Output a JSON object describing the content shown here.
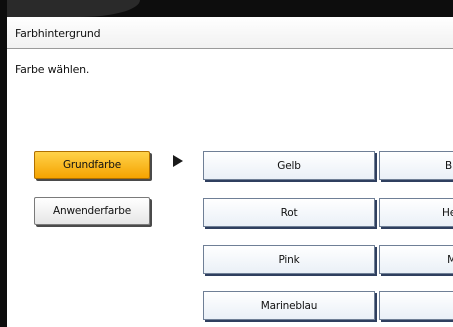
{
  "dialog": {
    "title": "Farbhintergrund",
    "instruction": "Farbe wählen."
  },
  "mode_buttons": [
    {
      "label": "Grundfarbe",
      "selected": true
    },
    {
      "label": "Anwenderfarbe",
      "selected": false
    }
  ],
  "selection_indicator": "arrow-right-icon",
  "colors": {
    "column1": [
      "Gelb",
      "Rot",
      "Pink",
      "Marineblau"
    ],
    "column2": [
      "B",
      "He",
      "M",
      ""
    ]
  },
  "theme": {
    "selected_button": "#f5a300",
    "button_border": "#6f7f96",
    "bezel": "#0d0d0d"
  }
}
